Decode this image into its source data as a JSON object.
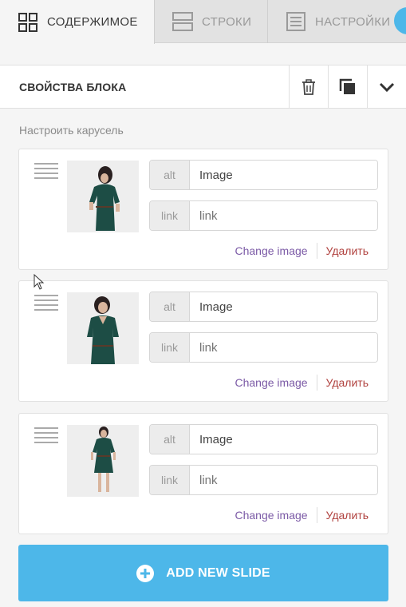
{
  "tabs": [
    {
      "label": "СОДЕРЖИМОЕ",
      "icon": "grid-icon",
      "active": true
    },
    {
      "label": "СТРОКИ",
      "icon": "rows-icon",
      "active": false
    },
    {
      "label": "НАСТРОЙКИ",
      "icon": "settings-list-icon",
      "active": false
    }
  ],
  "header": {
    "title": "СВОЙСТВА БЛОКА",
    "buttons": [
      "trash-icon",
      "duplicate-icon",
      "chevron-down-icon"
    ]
  },
  "section_label": "Настроить карусель",
  "slides": [
    {
      "alt_addon": "alt",
      "alt_value": "Image",
      "link_addon": "link",
      "link_placeholder": "link",
      "change_label": "Change image",
      "delete_label": "Удалить"
    },
    {
      "alt_addon": "alt",
      "alt_value": "Image",
      "link_addon": "link",
      "link_placeholder": "link",
      "change_label": "Change image",
      "delete_label": "Удалить"
    },
    {
      "alt_addon": "alt",
      "alt_value": "Image",
      "link_addon": "link",
      "link_placeholder": "link",
      "change_label": "Change image",
      "delete_label": "Удалить"
    }
  ],
  "add_button": {
    "label": "ADD NEW SLIDE",
    "icon": "plus-circle-icon"
  },
  "colors": {
    "accent": "#4db7e9",
    "link_purple": "#7b5aa6",
    "delete_red": "#b0413e",
    "dress_green": "#1d4d45"
  }
}
